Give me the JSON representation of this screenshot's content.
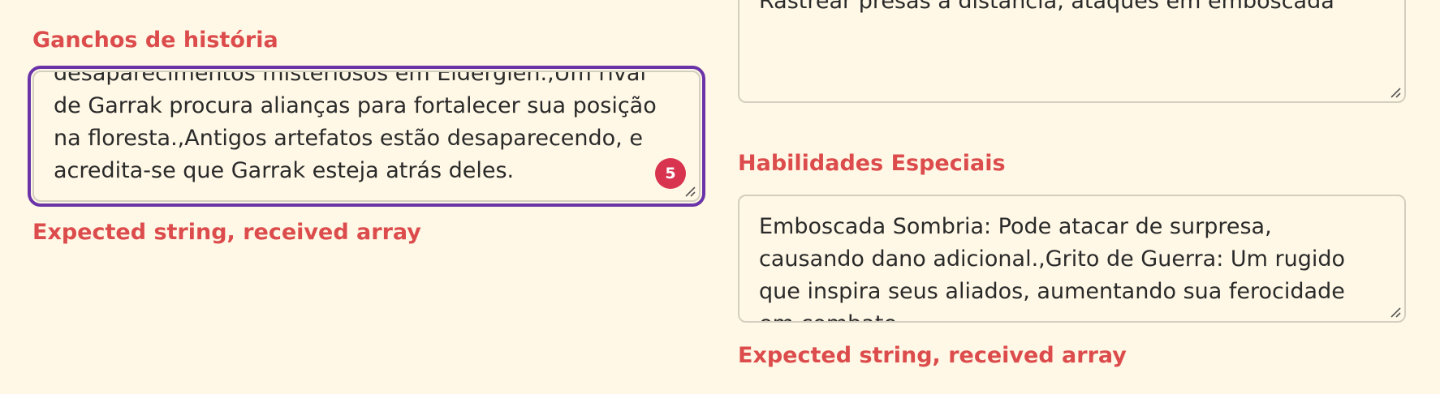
{
  "left_column": {
    "story_hooks": {
      "label": "Ganchos de história",
      "value": "desaparecimentos misteriosos em Eldergien.,Um rival de Garrak procura alianças para fortalecer sua posição na floresta.,Antigos artefatos estão desaparecendo, e acredita-se que Garrak esteja atrás deles.",
      "badge_count": "5",
      "error": "Expected string, received array"
    }
  },
  "right_column": {
    "top_field": {
      "value": "Rastrear presas à distância, ataques em emboscada"
    },
    "special_abilities": {
      "label": "Habilidades Especiais",
      "value": "Emboscada Sombria: Pode atacar de surpresa, causando dano adicional.,Grito de Guerra: Um rugido que inspira seus aliados, aumentando sua ferocidade em combate.",
      "error": "Expected string, received array"
    }
  },
  "colors": {
    "background": "#fff8e6",
    "error_red": "#dc4c4c",
    "focus_purple": "#6a34a8",
    "badge_red": "#d8344f",
    "field_border": "#d3cebf"
  }
}
